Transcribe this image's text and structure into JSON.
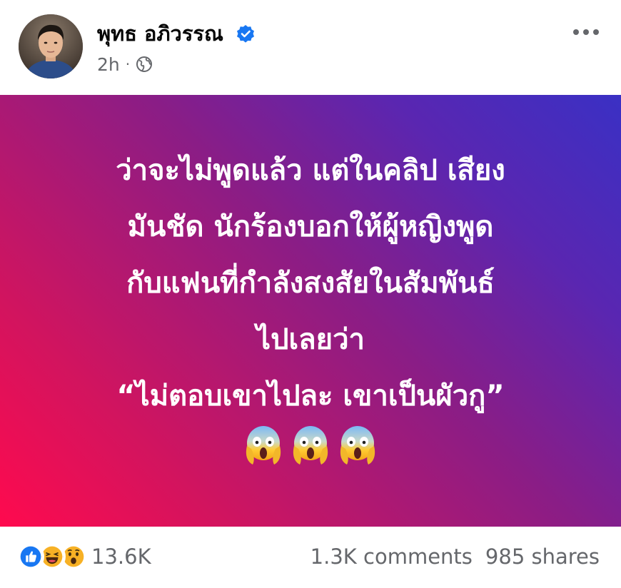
{
  "post": {
    "author": "พุทธ อภิวรรณ",
    "time": "2h",
    "separator": "·",
    "privacy_icon": "globe-icon",
    "verified_icon": "verified-badge-icon",
    "more_icon": "more-options-icon",
    "text_lines": [
      "ว่าจะไม่พูดแล้ว แต่ในคลิป เสียง",
      "มันชัด นักร้องบอกให้ผู้หญิงพูด",
      "กับแฟนที่กำลังสงสัยในสัมพันธ์",
      "ไปเลยว่า",
      "“ไม่ตอบเขาไปละ เขาเป็นผัวกู”"
    ],
    "emoji_icons": [
      "face-screaming-in-fear-icon",
      "face-screaming-in-fear-icon",
      "face-screaming-in-fear-icon"
    ],
    "background_colors": [
      "#ff0a4e",
      "#8a1d86",
      "#3a30c4"
    ]
  },
  "footer": {
    "reaction_icons": [
      "like-icon",
      "haha-icon",
      "wow-icon"
    ],
    "reaction_count": "13.6K",
    "comments": "1.3K comments",
    "shares": "985 shares"
  },
  "colors": {
    "text_secondary": "#65676b",
    "like_blue": "#1877f2",
    "verified_blue": "#1877f2"
  }
}
